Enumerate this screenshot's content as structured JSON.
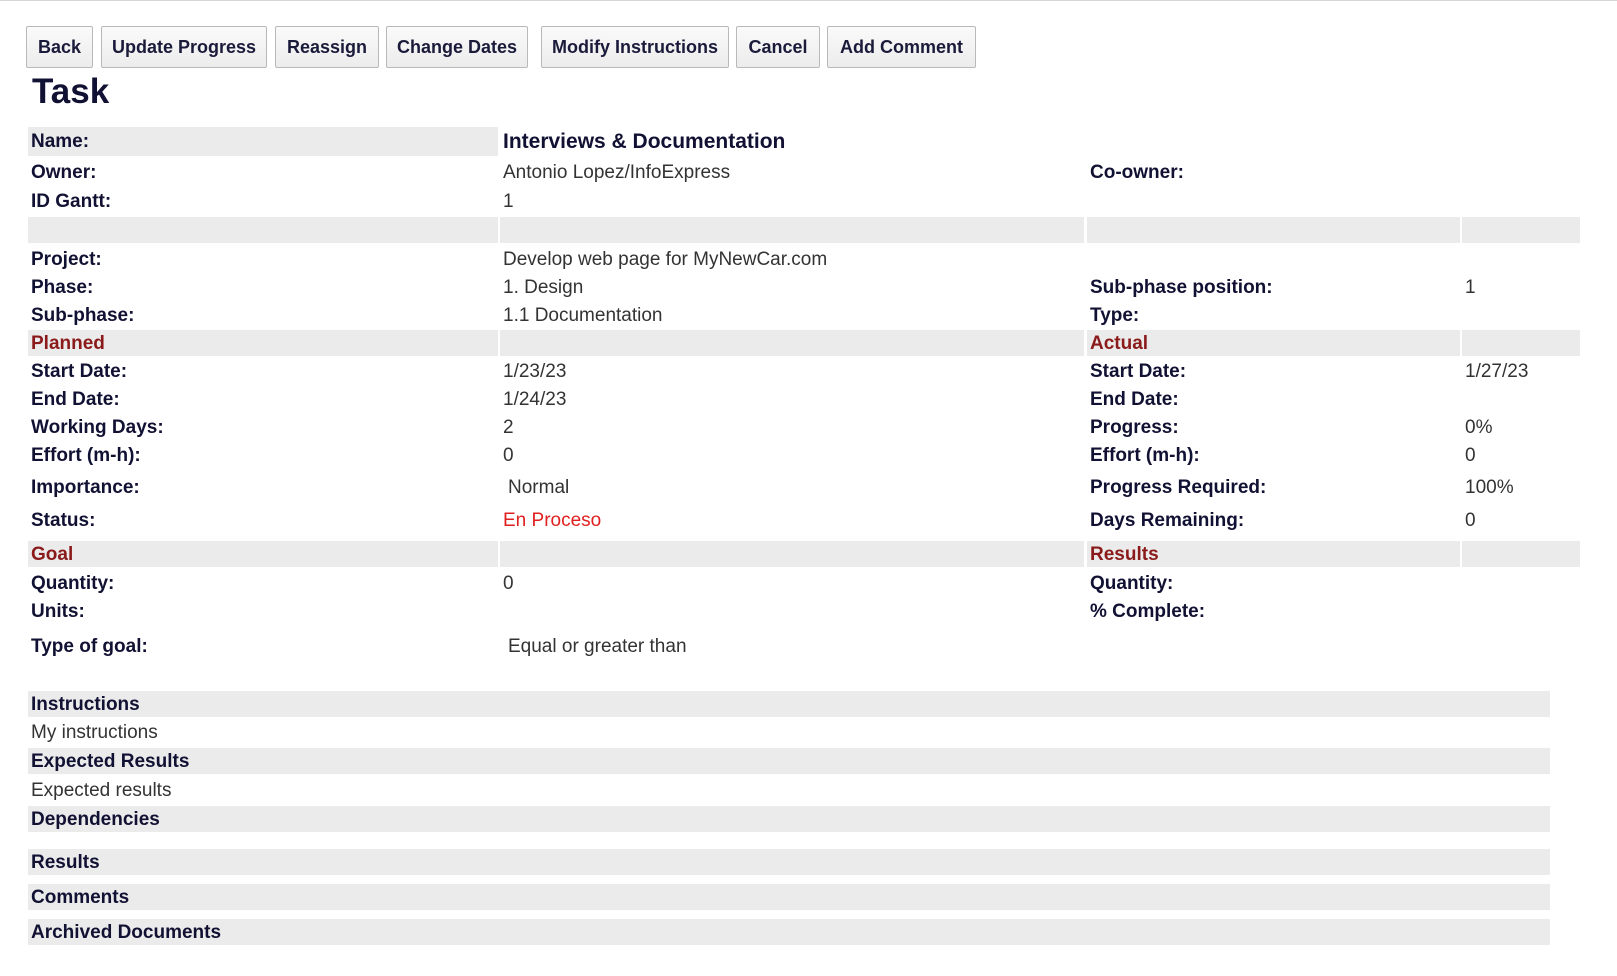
{
  "toolbar": {
    "buttons": [
      "Back",
      "Update Progress",
      "Reassign",
      "Change Dates",
      "Modify Instructions",
      "Cancel",
      "Add Comment"
    ]
  },
  "page_title": "Task",
  "task": {
    "name_label": "Name:",
    "name_value": "Interviews & Documentation",
    "owner_label": "Owner:",
    "owner_value": "Antonio Lopez/InfoExpress",
    "coowner_label": "Co-owner:",
    "coowner_value": "",
    "idgantt_label": "ID Gantt:",
    "idgantt_value": "1",
    "project_label": "Project:",
    "project_value": "Develop web page for MyNewCar.com",
    "phase_label": "Phase:",
    "phase_value": "1. Design",
    "subphase_pos_label": "Sub-phase position:",
    "subphase_pos_value": "1",
    "subphase_label": "Sub-phase:",
    "subphase_value": "1.1 Documentation",
    "type_label": "Type:",
    "type_value": ""
  },
  "planned": {
    "header": "Planned",
    "start_label": "Start Date:",
    "start_value": "1/23/23",
    "end_label": "End Date:",
    "end_value": "1/24/23",
    "workdays_label": "Working Days:",
    "workdays_value": "2",
    "effort_label": "Effort (m-h):",
    "effort_value": "0",
    "importance_label": "Importance:",
    "importance_value": "Normal",
    "status_label": "Status:",
    "status_value": "En Proceso"
  },
  "actual": {
    "header": "Actual",
    "start_label": "Start Date:",
    "start_value": "1/27/23",
    "end_label": "End Date:",
    "end_value": "",
    "progress_label": "Progress:",
    "progress_value": "0%",
    "effort_label": "Effort (m-h):",
    "effort_value": "0",
    "progress_req_label": "Progress Required:",
    "progress_req_value": "100%",
    "days_rem_label": "Days Remaining:",
    "days_rem_value": "0"
  },
  "goal": {
    "header": "Goal",
    "quantity_label": "Quantity:",
    "quantity_value": "0",
    "units_label": "Units:",
    "units_value": "",
    "type_label": "Type of goal:",
    "type_value": "Equal or greater than"
  },
  "results": {
    "header": "Results",
    "quantity_label": "Quantity:",
    "quantity_value": "",
    "complete_label": "% Complete:",
    "complete_value": ""
  },
  "blocks": {
    "instructions_header": "Instructions",
    "instructions_body": "My instructions",
    "expected_header": "Expected Results",
    "expected_body": "Expected results",
    "dependencies_header": "Dependencies",
    "results_header": "Results",
    "comments_header": "Comments",
    "archived_header": "Archived Documents"
  },
  "colors": {
    "section_header": "#8b1a1a",
    "status_text": "#e02020",
    "row_shade": "#ebebeb"
  }
}
